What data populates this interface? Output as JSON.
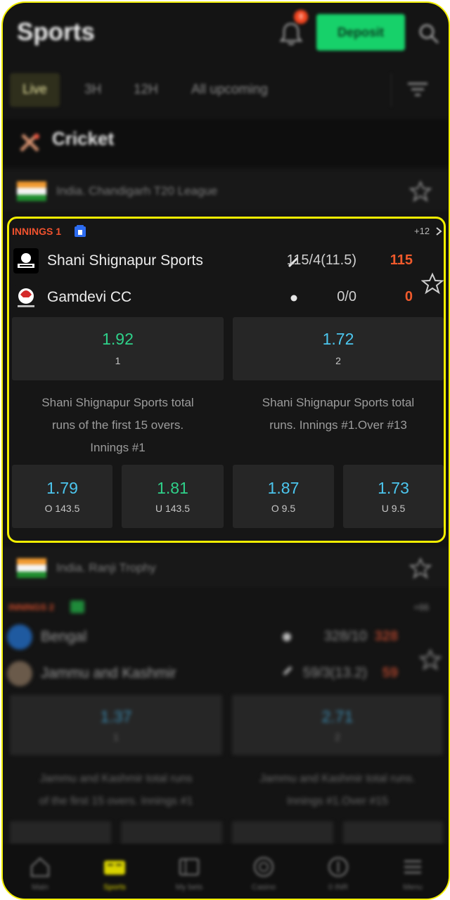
{
  "header": {
    "title": "Sports",
    "notification_count": "8",
    "deposit_label": "Deposit"
  },
  "tabs": [
    {
      "label": "Live",
      "active": true
    },
    {
      "label": "3H",
      "active": false
    },
    {
      "label": "12H",
      "active": false
    },
    {
      "label": "All upcoming",
      "active": false
    }
  ],
  "sport": {
    "name": "Cricket"
  },
  "league1": {
    "name": "India. Chandigarh T20 League"
  },
  "match1": {
    "status": "INNINGS 1",
    "more_markets": "+12",
    "team1": {
      "name": "Shani Shignapur Sports",
      "score": "115/4(11.5)",
      "runs": "115"
    },
    "team2": {
      "name": "Gamdevi CC",
      "score": "0/0",
      "runs": "0"
    },
    "main_odds": [
      {
        "value": "1.92",
        "label": "1",
        "color": "#2fd18a"
      },
      {
        "value": "1.72",
        "label": "2",
        "color": "#4cc6ee"
      }
    ],
    "market_left": {
      "line1": "Shani Shignapur Sports total",
      "line2": "runs of the first 15 overs.",
      "line3": "Innings #1"
    },
    "market_right": {
      "line1": "Shani Shignapur Sports total",
      "line2": "runs. Innings #1.Over #13"
    },
    "total_odds": [
      {
        "value": "1.79",
        "label": "O 143.5",
        "color": "#4cc6ee"
      },
      {
        "value": "1.81",
        "label": "U 143.5",
        "color": "#2fd18a"
      },
      {
        "value": "1.87",
        "label": "O 9.5",
        "color": "#4cc6ee"
      },
      {
        "value": "1.73",
        "label": "U 9.5",
        "color": "#4cc6ee"
      }
    ]
  },
  "league2": {
    "name": "India. Ranji Trophy"
  },
  "match2": {
    "status": "INNINGS 2",
    "more_markets": "+66",
    "team1": {
      "name": "Bengal",
      "score": "328/10",
      "runs": "328"
    },
    "team2": {
      "name": "Jammu and Kashmir",
      "score": "59/3(13.2)",
      "runs": "59"
    },
    "main_odds": [
      {
        "value": "1.37",
        "label": "1"
      },
      {
        "value": "2.71",
        "label": "2"
      }
    ],
    "market_left": {
      "line1": "Jammu and Kashmir total runs",
      "line2": "of the first 15 overs. Innings #1"
    },
    "market_right": {
      "line1": "Jammu and Kashmir total runs.",
      "line2": "Innings #1.Over #15"
    }
  },
  "bottom_nav": [
    {
      "label": "Main",
      "active": false
    },
    {
      "label": "Sports",
      "active": true
    },
    {
      "label": "My bets",
      "active": false
    },
    {
      "label": "Casino",
      "active": false
    },
    {
      "label": "0 INR",
      "active": false
    },
    {
      "label": "Menu",
      "active": false
    }
  ],
  "colors": {
    "accent": "#f2ee00",
    "deposit": "#17d16a",
    "live_status": "#f0522e",
    "odd_green": "#2fd18a",
    "odd_blue": "#4cc6ee"
  }
}
